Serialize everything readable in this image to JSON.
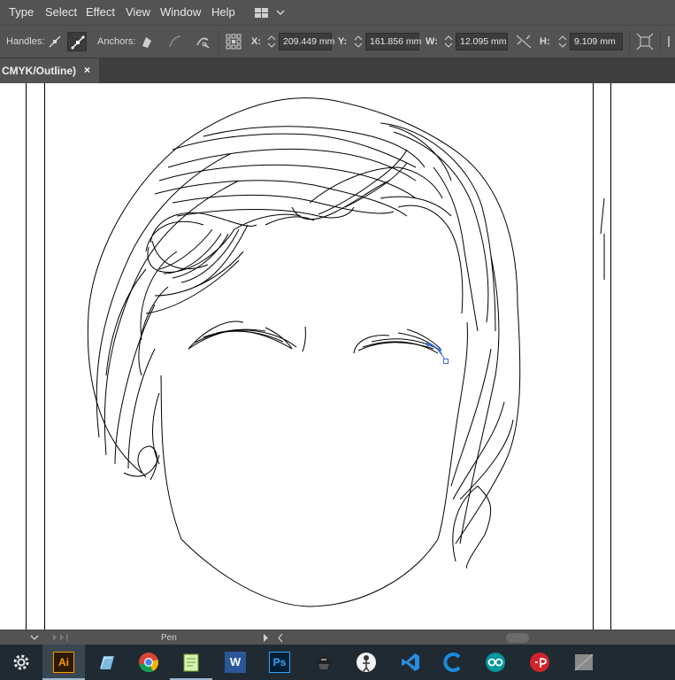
{
  "menubar": {
    "items": [
      "Type",
      "Select",
      "Effect",
      "View",
      "Window",
      "Help"
    ],
    "workspace_icon": "workspace-grid-icon"
  },
  "controlbar": {
    "handles_label": "Handles:",
    "anchors_label": "Anchors:",
    "x_label": "X:",
    "x_value": "209.449 mm",
    "y_label": "Y:",
    "y_value": "161.856 mm",
    "w_label": "W:",
    "w_value": "12.095 mm",
    "h_label": "H:",
    "h_value": "9.109 mm"
  },
  "document_tab": {
    "title": "CMYK/Outline)",
    "close_glyph": "×"
  },
  "statusbar": {
    "current_tool": "Pen"
  },
  "colors": {
    "ui_background": "#535353",
    "canvas": "#ffffff",
    "selection": "#3a6fd8",
    "taskbar": "#1f2a33"
  },
  "taskbar": {
    "apps": [
      "settings-icon",
      "illustrator-icon",
      "notepad-icon",
      "chrome-icon",
      "notepadplus-icon",
      "word-icon",
      "photoshop-icon",
      "inkscape-icon",
      "inkscape-alt-icon",
      "vscode-icon",
      "cura-icon",
      "arduino-icon",
      "processing-icon",
      "display-icon"
    ],
    "active_app": "illustrator-icon",
    "illustrator_label": "Ai",
    "photoshop_label": "Ps",
    "word_label": "W"
  }
}
